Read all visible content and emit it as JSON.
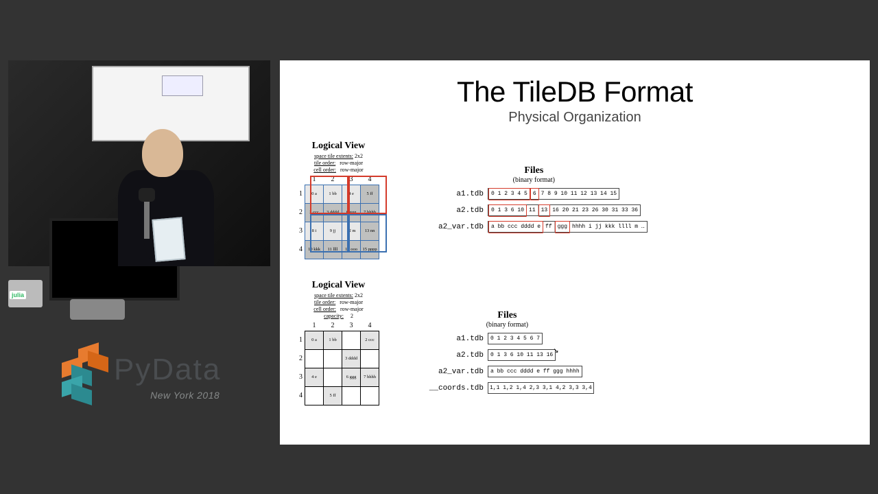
{
  "video": {
    "sticker": "julia"
  },
  "logo": {
    "brand": "PyData",
    "sub": "New York 2018"
  },
  "slide": {
    "title": "The TileDB Format",
    "subtitle": "Physical Organization"
  },
  "dense": {
    "title": "Logical View",
    "meta_html": "space tile extents: 2x2 | tile order: row-major | cell order: row-major",
    "meta1a": "space tile extents:",
    "meta1b": "2x2",
    "meta2a": "tile order:",
    "meta2b": "row-major",
    "meta3a": "cell order:",
    "meta3b": "row-major",
    "cols": [
      "1",
      "2",
      "3",
      "4"
    ],
    "rows": [
      "1",
      "2",
      "3",
      "4"
    ],
    "cells": [
      [
        "0 a",
        "1 bb",
        "4 e",
        "5 ff"
      ],
      [
        "2 ccc",
        "3 dddd",
        "6 ggg",
        "7 hhhh"
      ],
      [
        "8 i",
        "9 jj",
        "12 m",
        "13 nn"
      ],
      [
        "10 kkk",
        "11 llll",
        "14 ooo",
        "15 pppp"
      ]
    ]
  },
  "sparse": {
    "title": "Logical View",
    "meta1a": "space tile extents:",
    "meta1b": "2x2",
    "meta2a": "tile order:",
    "meta2b": "row-major",
    "meta3a": "cell order:",
    "meta3b": "row-major",
    "meta4a": "capacity:",
    "meta4b": "2",
    "cols": [
      "1",
      "2",
      "3",
      "4"
    ],
    "rows": [
      "1",
      "2",
      "3",
      "4"
    ],
    "cells": [
      [
        "0 a",
        "1 bb",
        "",
        "2 ccc"
      ],
      [
        "",
        "",
        "3 dddd",
        ""
      ],
      [
        "4 e",
        "",
        "6 ggg",
        "7 hhhh"
      ],
      [
        "",
        "5 ff",
        "",
        ""
      ]
    ]
  },
  "files1": {
    "title": "Files",
    "sub": "(binary format)",
    "rows": [
      {
        "name": "a1.tdb",
        "cells": [
          "0 1 2 3 4 5",
          "6",
          "7 8 9 10 11 12 13 14 15"
        ]
      },
      {
        "name": "a2.tdb",
        "cells": [
          "0 1 3 6 10",
          "11",
          "13",
          "16 20 21 23 26 30 31 33 36"
        ]
      },
      {
        "name": "a2_var.tdb",
        "cells": [
          "a bb ccc dddd e",
          "ff",
          "ggg",
          "hhhh i jj kkk llll m …"
        ]
      }
    ]
  },
  "files2": {
    "title": "Files",
    "sub": "(binary format)",
    "rows": [
      {
        "name": "a1.tdb",
        "cells": [
          "0 1 2 3 4 5 6 7"
        ]
      },
      {
        "name": "a2.tdb",
        "cells": [
          "0 1 3 6 10 11 13 16"
        ]
      },
      {
        "name": "a2_var.tdb",
        "cells": [
          "a bb ccc dddd e ff ggg hhhh"
        ]
      },
      {
        "name": "__coords.tdb",
        "cells": [
          "1,1 1,2 1,4 2,3 3,1 4,2 3,3 3,4"
        ]
      }
    ]
  }
}
